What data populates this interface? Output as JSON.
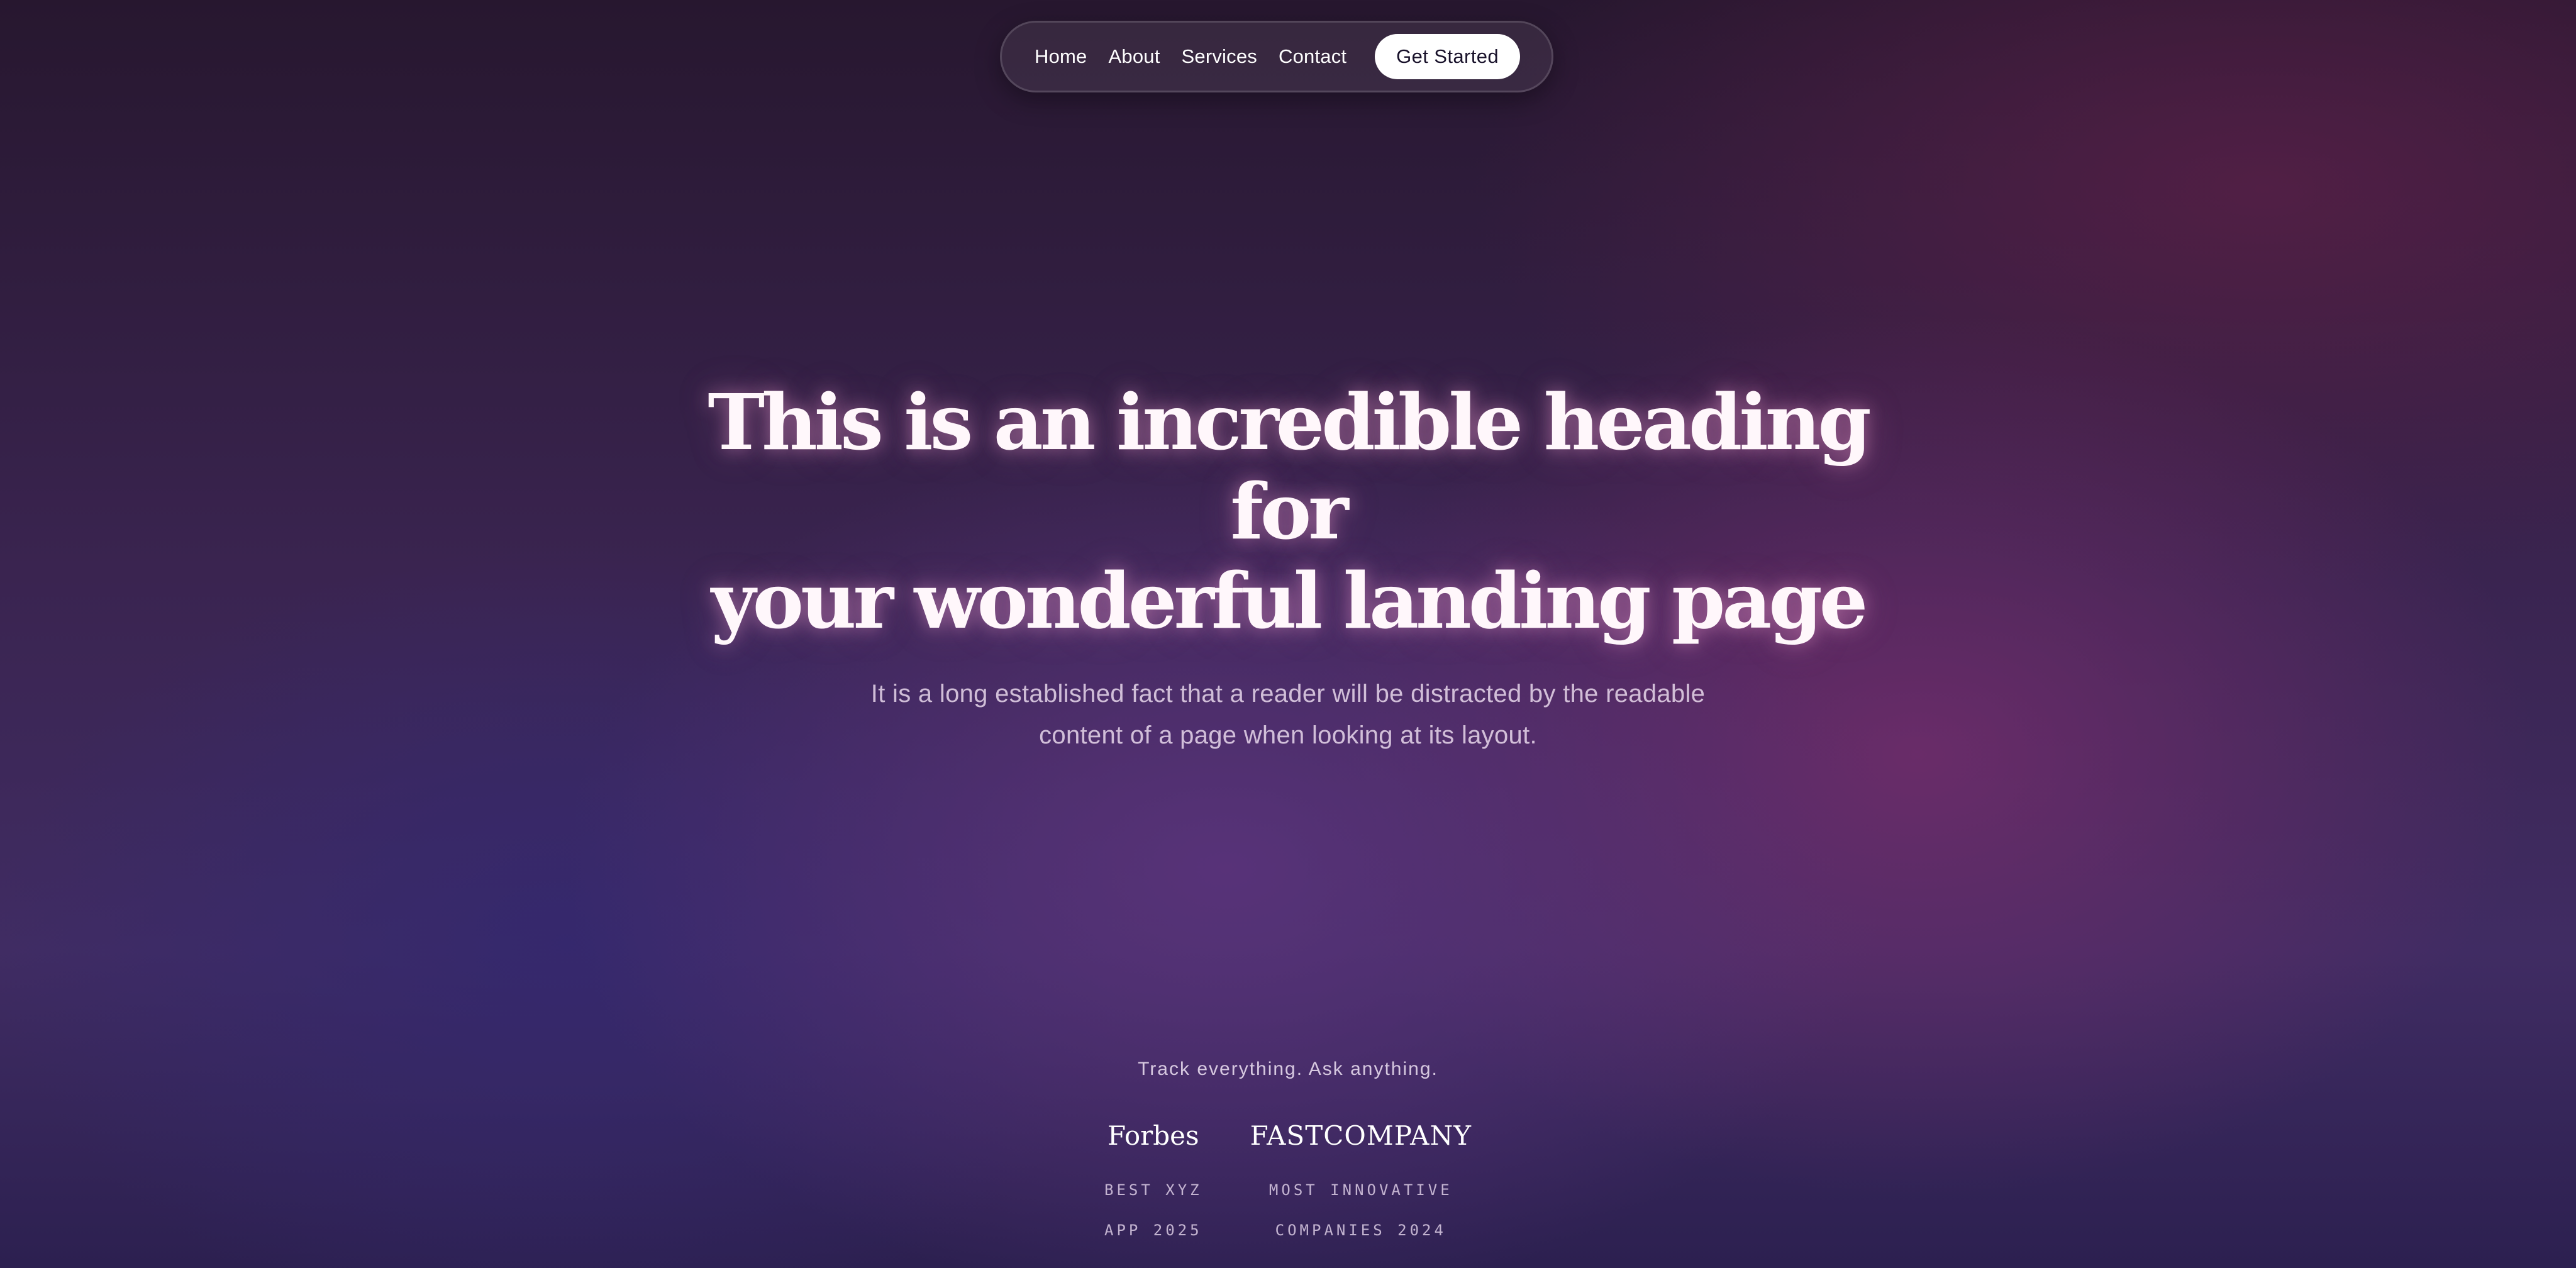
{
  "nav": {
    "links": [
      {
        "label": "Home"
      },
      {
        "label": "About"
      },
      {
        "label": "Services"
      },
      {
        "label": "Contact"
      }
    ],
    "cta_label": "Get Started"
  },
  "hero": {
    "title_line1": "This is an incredible heading for",
    "title_line2": "your wonderful landing page",
    "subtitle_line1": "It is a long established fact that a reader will be distracted by the readable",
    "subtitle_line2": "content of a page when looking at its layout."
  },
  "footer": {
    "tagline": "Track everything. Ask anything.",
    "press": [
      {
        "logo": "Forbes",
        "caption_line1": "BEST XYZ",
        "caption_line2": "APP 2025"
      },
      {
        "logo": "FASTCOMPANY",
        "caption_line1": "MOST INNOVATIVE",
        "caption_line2": "COMPANIES 2024"
      }
    ]
  }
}
